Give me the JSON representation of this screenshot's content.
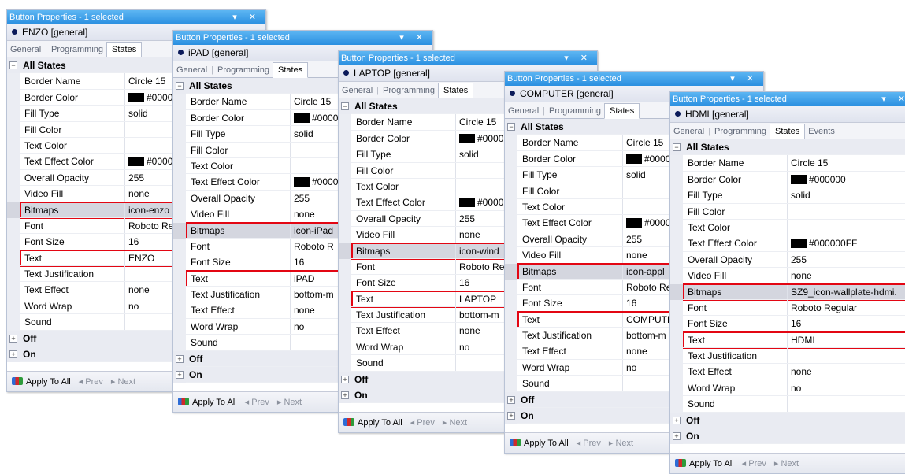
{
  "title": "Button Properties - 1 selected",
  "window_controls": "▾ ✕",
  "tabs": [
    "General",
    "Programming",
    "States",
    "Events"
  ],
  "category_all": "All States",
  "category_off": "Off",
  "category_on": "On",
  "footer": {
    "apply": "Apply To All",
    "prev": "Prev",
    "next": "Next"
  },
  "panels": [
    {
      "object": "ENZO  [general]",
      "values": {
        "border_name": "Circle 15",
        "border_color": "#0000",
        "fill_type": "solid",
        "text_effect_color": "#0000",
        "opacity": "255",
        "video_fill": "none",
        "bitmaps": "icon-enzo",
        "font": "Roboto Re",
        "font_size": "16",
        "text": "ENZO",
        "text_justification": "",
        "text_effect": "none",
        "word_wrap": "no"
      }
    },
    {
      "object": "iPAD  [general]",
      "values": {
        "border_name": "Circle 15",
        "border_color": "#0000",
        "fill_type": "solid",
        "text_effect_color": "#0000",
        "opacity": "255",
        "video_fill": "none",
        "bitmaps": "icon-iPad",
        "font": "Roboto R",
        "font_size": "16",
        "text": "iPAD",
        "text_justification": "bottom-m",
        "text_effect": "none",
        "word_wrap": "no"
      }
    },
    {
      "object": "LAPTOP  [general]",
      "values": {
        "border_name": "Circle 15",
        "border_color": "#0000",
        "fill_type": "solid",
        "text_effect_color": "#0000",
        "opacity": "255",
        "video_fill": "none",
        "bitmaps": "icon-wind",
        "font": "Roboto Re",
        "font_size": "16",
        "text": "LAPTOP",
        "text_justification": "bottom-m",
        "text_effect": "none",
        "word_wrap": "no"
      }
    },
    {
      "object": "COMPUTER  [general]",
      "values": {
        "border_name": "Circle 15",
        "border_color": "#0000",
        "fill_type": "solid",
        "text_effect_color": "#0000",
        "opacity": "255",
        "video_fill": "none",
        "bitmaps": "icon-appl",
        "font": "Roboto Re",
        "font_size": "16",
        "text": "COMPUTE",
        "text_justification": "bottom-m",
        "text_effect": "none",
        "word_wrap": "no"
      }
    },
    {
      "object": "HDMI  [general]",
      "values": {
        "border_name": "Circle 15",
        "border_color": "#000000",
        "fill_type": "solid",
        "text_effect_color": "#000000FF",
        "opacity": "255",
        "video_fill": "none",
        "bitmaps": "SZ9_icon-wallplate-hdmi.",
        "font": "Roboto Regular",
        "font_size": "16",
        "text": "HDMI",
        "text_justification": "",
        "text_effect": "none",
        "word_wrap": "no"
      }
    }
  ],
  "property_labels": {
    "border_name": "Border Name",
    "border_color": "Border Color",
    "fill_type": "Fill Type",
    "fill_color": "Fill Color",
    "text_color": "Text Color",
    "text_effect_color": "Text Effect Color",
    "opacity": "Overall Opacity",
    "video_fill": "Video Fill",
    "bitmaps": "Bitmaps",
    "font": "Font",
    "font_size": "Font Size",
    "text": "Text",
    "text_justification": "Text Justification",
    "text_effect": "Text Effect",
    "word_wrap": "Word Wrap",
    "sound": "Sound"
  },
  "colors": {
    "title_bar": "#2a8fe0",
    "highlight": "#e30613",
    "swatch": "#000000"
  }
}
